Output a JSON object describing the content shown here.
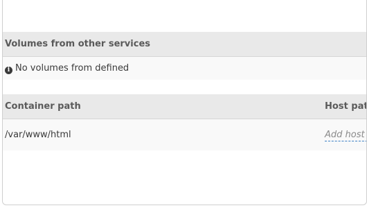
{
  "volumes_from": {
    "header": "Volumes from other services",
    "empty_message": "No volumes from defined"
  },
  "volumes": {
    "columns": {
      "container_path": "Container path",
      "host_path": "Host path"
    },
    "rows": [
      {
        "container_path": "/var/www/html",
        "host_path_placeholder": "Add host path"
      }
    ]
  },
  "icons": {
    "info": "info-icon"
  },
  "colors": {
    "header_bg": "#e9e9e9",
    "row_bg": "#f9f9f9",
    "link_underline": "#3b7fc4"
  }
}
